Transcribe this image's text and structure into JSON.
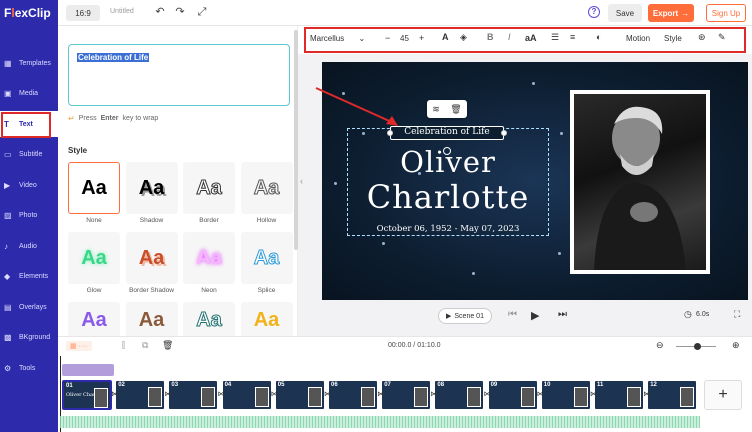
{
  "app": {
    "logo_prefix": "F",
    "logo_x": "l",
    "logo_rest": "exClip"
  },
  "sidebar": {
    "items": [
      {
        "label": "Templates",
        "icon": "templates-icon"
      },
      {
        "label": "Media",
        "icon": "media-icon"
      },
      {
        "label": "Text",
        "icon": "text-icon"
      },
      {
        "label": "Subtitle",
        "icon": "subtitle-icon"
      },
      {
        "label": "Video",
        "icon": "video-icon"
      },
      {
        "label": "Photo",
        "icon": "photo-icon"
      },
      {
        "label": "Audio",
        "icon": "audio-icon"
      },
      {
        "label": "Elements",
        "icon": "elements-icon"
      },
      {
        "label": "Overlays",
        "icon": "overlays-icon"
      },
      {
        "label": "BKground",
        "icon": "background-icon"
      },
      {
        "label": "Tools",
        "icon": "tools-icon"
      }
    ],
    "active": "Text"
  },
  "topbar": {
    "ratio": "16:9",
    "project_title": "Untitled",
    "save_label": "Save",
    "export_label": "Export",
    "signup_label": "Sign Up"
  },
  "text_panel": {
    "input_value": "Celebration of Life",
    "hint_prefix": "Press",
    "hint_key": "Enter",
    "hint_suffix": "key to wrap",
    "style_title": "Style",
    "styles": [
      {
        "sample": "Aa",
        "label": "None"
      },
      {
        "sample": "Aa",
        "label": "Shadow"
      },
      {
        "sample": "Aa",
        "label": "Border"
      },
      {
        "sample": "Aa",
        "label": "Hollow"
      },
      {
        "sample": "Aa",
        "label": "Glow"
      },
      {
        "sample": "Aa",
        "label": "Border Shadow"
      },
      {
        "sample": "Aa",
        "label": "Neon"
      },
      {
        "sample": "Aa",
        "label": "Splice"
      },
      {
        "sample": "Aa",
        "label": ""
      },
      {
        "sample": "Aa",
        "label": ""
      },
      {
        "sample": "Aa",
        "label": ""
      },
      {
        "sample": "Aa",
        "label": ""
      }
    ]
  },
  "text_toolbar": {
    "font": "Marcellus",
    "size": "45",
    "case_label": "aA",
    "motion_label": "Motion",
    "style_label": "Style"
  },
  "canvas": {
    "ribbon_text": "Celebration of Life",
    "first_name": "Oliver",
    "last_name": "Charlotte",
    "dates": "October 06, 1952 - May 07, 2023"
  },
  "player": {
    "scene_label": "Scene 01",
    "duration": "6.0s"
  },
  "timeline": {
    "timecode": "00:00.0 / 01:10.0",
    "scenes": [
      {
        "num": "01",
        "title": "Oliver Charlotte"
      },
      {
        "num": "02",
        "title": ""
      },
      {
        "num": "03",
        "title": ""
      },
      {
        "num": "04",
        "title": ""
      },
      {
        "num": "05",
        "title": ""
      },
      {
        "num": "06",
        "title": ""
      },
      {
        "num": "07",
        "title": ""
      },
      {
        "num": "08",
        "title": ""
      },
      {
        "num": "09",
        "title": ""
      },
      {
        "num": "10",
        "title": ""
      },
      {
        "num": "11",
        "title": ""
      },
      {
        "num": "12",
        "title": ""
      }
    ],
    "add_label": "+"
  },
  "colors": {
    "sidebar_bg": "#2d2bab",
    "accent": "#ff6d3b",
    "annotation_red": "#e02a2a",
    "canvas_bg": "#0d1e31"
  }
}
